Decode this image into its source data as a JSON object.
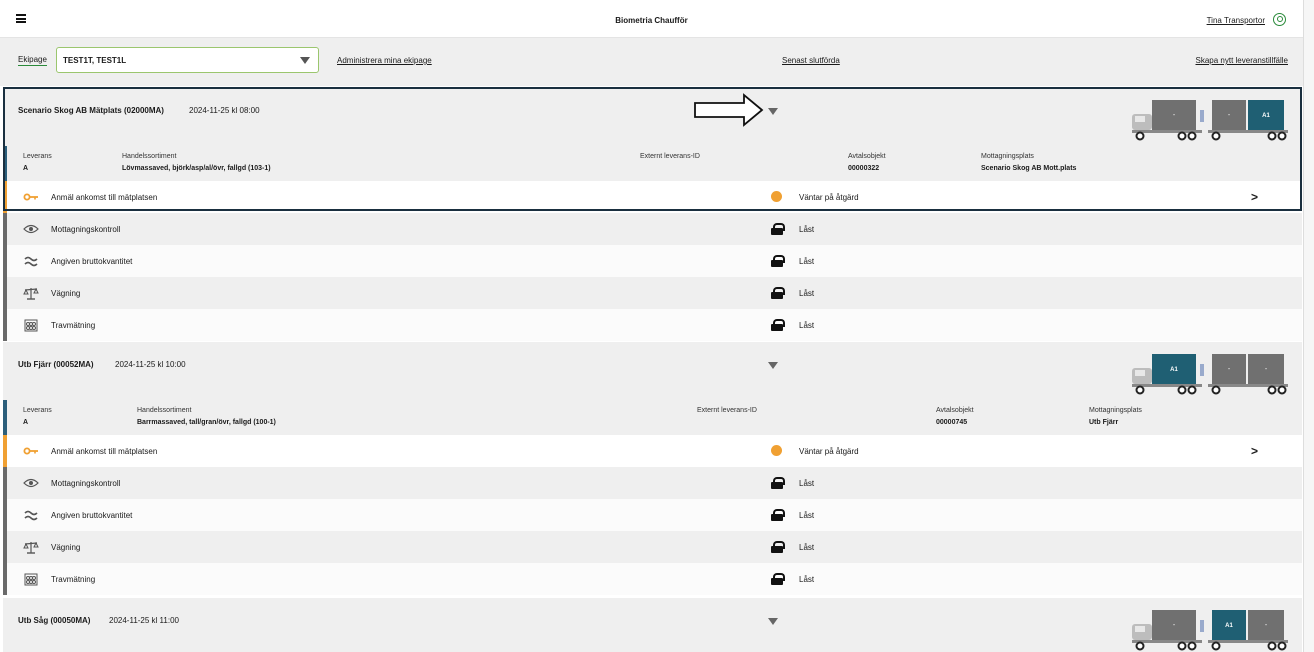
{
  "header": {
    "title": "Biometria Chaufför",
    "user": "Tina Transportor"
  },
  "toolbar": {
    "ekipage_label": "Ekipage",
    "ekipage_value": "TEST1T, TEST1L",
    "administrera": "Administrera mina ekipage",
    "senast": "Senast slutförda",
    "skapa": "Skapa nytt leveranstillfälle"
  },
  "labels": {
    "leverans": "Leverans",
    "handelssortiment": "Handelssortiment",
    "externt": "Externt leverans-ID",
    "avtalsobjekt": "Avtalsobjekt",
    "mottagningsplats": "Mottagningsplats"
  },
  "steps": [
    {
      "name": "Anmäl ankomst till mätplatsen",
      "status": "Väntar på åtgärd",
      "icon": "key-icon"
    },
    {
      "name": "Mottagningskontroll",
      "status": "Låst",
      "icon": "eye-icon"
    },
    {
      "name": "Angiven bruttokvantitet",
      "status": "Låst",
      "icon": "approx-icon"
    },
    {
      "name": "Vägning",
      "status": "Låst",
      "icon": "scale-icon"
    },
    {
      "name": "Travmätning",
      "status": "Låst",
      "icon": "stack-measure-icon"
    }
  ],
  "go_glyph": ">",
  "deliveries": [
    {
      "title": "Scenario Skog AB Mätplats (02000MA)",
      "date": "2024-11-25 kl 08:00",
      "leverans": "A",
      "handelssortiment": "Lövmassaved, björk/asp/al/övr, fallgd (103-1)",
      "externt": "",
      "avtalsobjekt": "00000322",
      "mottagningsplats": "Scenario Skog AB Mott.plats",
      "truck": {
        "boxes": [
          "-",
          "-",
          "A1"
        ]
      }
    },
    {
      "title": "Utb Fjärr (00052MA)",
      "date": "2024-11-25 kl 10:00",
      "leverans": "A",
      "handelssortiment": "Barrmassaved, tall/gran/övr, fallgd (100-1)",
      "externt": "",
      "avtalsobjekt": "00000745",
      "mottagningsplats": "Utb Fjärr",
      "truck": {
        "boxes": [
          "A1",
          "-",
          "-"
        ]
      }
    },
    {
      "title": "Utb Såg (00050MA)",
      "date": "2024-11-25 kl 11:00",
      "truck": {
        "boxes": [
          "-",
          "A1",
          "-"
        ]
      }
    }
  ],
  "colors": {
    "accent_green": "#2a8a3a",
    "pending": "#f0a032",
    "box_active": "#1f5f73",
    "box_empty": "#707070"
  }
}
